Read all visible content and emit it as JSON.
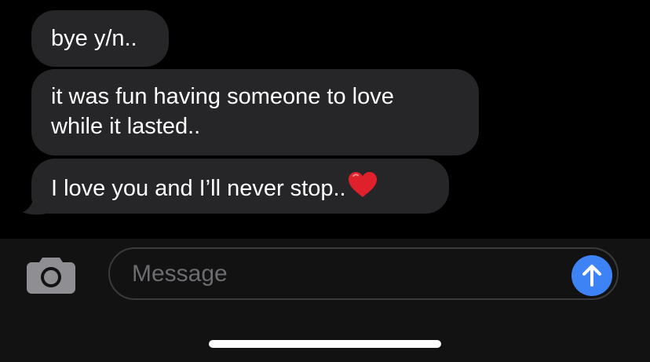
{
  "thread": {
    "messages": [
      {
        "lines": [
          "bye y/n.."
        ]
      },
      {
        "lines": [
          "it was fun having someone to love",
          "while it lasted.."
        ]
      },
      {
        "lines": [
          "I love you and I’ll never stop.."
        ],
        "emoji": "red-heart"
      }
    ]
  },
  "composer": {
    "placeholder": "Message",
    "camera_icon": "camera-icon",
    "send_icon": "arrow-up-icon"
  },
  "colors": {
    "background": "#000000",
    "bubble": "#262628",
    "toolbar": "#121212",
    "send_button": "#3e83f6",
    "heart": "#e0212b"
  }
}
